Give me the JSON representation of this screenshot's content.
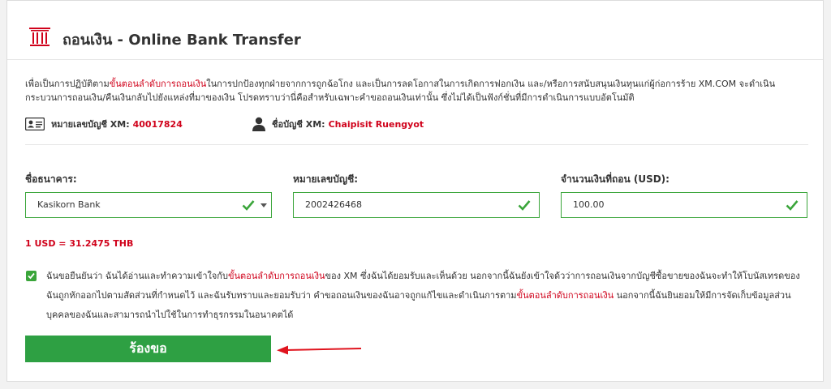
{
  "header": {
    "title": "ถอนเงิน - Online Bank Transfer",
    "icon": "bank-building-icon"
  },
  "intro": {
    "part1": "เพื่อเป็นการปฏิบัติตาม",
    "link1": "ขั้นตอนลำดับการถอนเงิน",
    "part2": "ในการปกป้องทุกฝ่ายจากการถูกฉ้อโกง และเป็นการลดโอกาสในการเกิดการฟอกเงิน และ/หรือการสนับสนุนเงินทุนแก่ผู้ก่อการร้าย XM.COM จะดำเนินกระบวนการถอนเงิน/คืนเงินกลับไปยังแหล่งที่มาของเงิน โปรดทราบว่านี่คือสำหรับเฉพาะคำขอถอนเงินเท่านั้น ซึ่งไม่ได้เป็นฟังก์ชั่นที่มีการดำเนินการแบบอัตโนมัติ"
  },
  "account": {
    "number_label": "หมายเลขบัญชี XM:",
    "number_value": "40017824",
    "name_label": "ชื่อบัญชี XM:",
    "name_value": "Chaipisit Ruengyot"
  },
  "form": {
    "bank_label": "ชื่อธนาคาร:",
    "bank_value": "Kasikorn Bank",
    "acct_label": "หมายเลขบัญชี:",
    "acct_value": "2002426468",
    "amount_label": "จำนวนเงินที่ถอน (USD):",
    "amount_value": "100.00"
  },
  "rate": "1 USD = 31.2475 THB",
  "agreement": {
    "checked": true,
    "part1": "ฉันขอยืนยันว่า ฉันได้อ่านและทำความเข้าใจกับ",
    "link1": "ขั้นตอนลำดับการถอนเงิน",
    "part2": "ของ XM ซึ่งฉันได้ยอมรับและเห็นด้วย นอกจากนี้ฉันยังเข้าใจด้วว่าการถอนเงินจากบัญชีซื้อขายของฉันจะทำให้โบนัสเทรดของฉันถูกหักออกไปตามสัดส่วนที่กำหนดไว้ และฉันรับทราบและยอมรับว่า คำขอถอนเงินของฉันอาจถูกแก้ไขและดำเนินการตาม",
    "link2": "ขั้นตอนลำดับการถอนเงิน",
    "part3": " นอกจากนี้ฉันยินยอมให้มีการจัดเก็บข้อมูลส่วนบุคคลของฉันและสามารถนำไปใช้ในการทำธุรกรรมในอนาคตได้"
  },
  "submit_label": "ร้องขอ",
  "colors": {
    "accent_green": "#2ea043",
    "link_red": "#d0021b",
    "arrow_red": "#e0141e"
  }
}
